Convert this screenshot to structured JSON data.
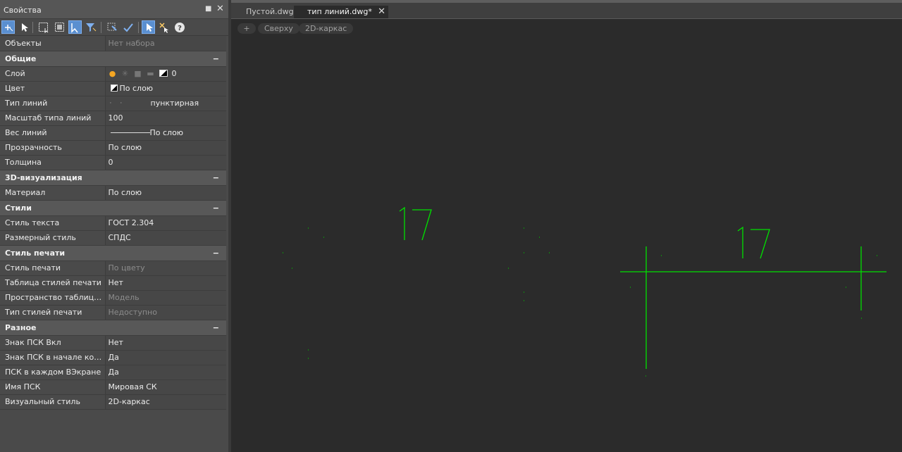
{
  "panel": {
    "title": "Свойства",
    "pin_icon": "pin-icon",
    "close_icon": "close-icon"
  },
  "toolbar": {
    "buttons": [
      "select-add-icon",
      "select-cursor-icon",
      "select-window-icon",
      "select-crossing-icon",
      "toggle-pickadd-icon",
      "filter-icon",
      "quick-select-icon",
      "match-props-icon",
      "pick-object-icon",
      "deselect-icon",
      "help-icon"
    ]
  },
  "properties": {
    "objects": {
      "key": "Объекты",
      "value": "Нет набора"
    },
    "general": {
      "header": "Общие",
      "layer": {
        "key": "Слой",
        "value": "0"
      },
      "color": {
        "key": "Цвет",
        "value": "По слою"
      },
      "linetype": {
        "key": "Тип линий",
        "value": "пунктирная"
      },
      "linetype_scale": {
        "key": "Масштаб типа линий",
        "value": "100"
      },
      "lineweight": {
        "key": "Вес линий",
        "value": "По слою"
      },
      "transparency": {
        "key": "Прозрачность",
        "value": "По слою"
      },
      "thickness": {
        "key": "Толщина",
        "value": "0"
      }
    },
    "viz3d": {
      "header": "3D-визуализация",
      "material": {
        "key": "Материал",
        "value": "По слою"
      }
    },
    "styles": {
      "header": "Стили",
      "text_style": {
        "key": "Стиль текста",
        "value": "ГОСТ 2.304"
      },
      "dim_style": {
        "key": "Размерный стиль",
        "value": "СПДС"
      }
    },
    "plot": {
      "header": "Стиль печати",
      "plot_style": {
        "key": "Стиль печати",
        "value": "По цвету"
      },
      "plot_table": {
        "key": "Таблица стилей печати",
        "value": "Нет"
      },
      "plot_table_space": {
        "key": "Пространство таблицы с…",
        "value": "Модель"
      },
      "plot_table_type": {
        "key": "Тип стилей печати",
        "value": "Недоступно"
      }
    },
    "misc": {
      "header": "Разное",
      "ucs_on": {
        "key": "Знак ПСК Вкл",
        "value": "Нет"
      },
      "ucs_origin": {
        "key": "Знак ПСК в начале коор…",
        "value": "Да"
      },
      "ucs_each_vp": {
        "key": "ПСК в каждом ВЭкране",
        "value": "Да"
      },
      "ucs_name": {
        "key": "Имя ПСК",
        "value": "Мировая СК"
      },
      "visual_style": {
        "key": "Визуальный стиль",
        "value": "2D-каркас"
      }
    }
  },
  "tabs": [
    {
      "label": "Пустой.dwg*"
    },
    {
      "label": "тип линий.dwg*"
    }
  ],
  "viewport": {
    "plus": "+",
    "view": "Сверху",
    "style": "2D-каркас"
  },
  "drawing": {
    "dim_text_1": "17",
    "dim_text_2": "17",
    "line_color": "#00e000"
  }
}
